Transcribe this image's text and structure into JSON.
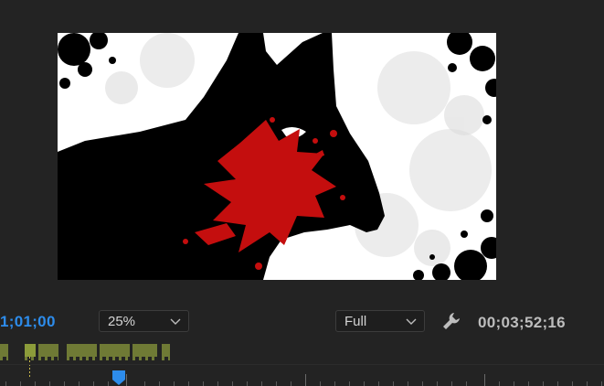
{
  "program_monitor": {
    "current_timecode": "1;01;00",
    "zoom_level": "25%",
    "playback_resolution": "Full",
    "duration_timecode": "00;03;52;16",
    "icons": {
      "settings": "wrench-icon",
      "dropdown": "chevron-down-icon",
      "playhead": "playhead-icon"
    }
  },
  "colors": {
    "timecode_blue": "#2d8ceb",
    "marker_green": "#6f7a35",
    "panel_bg": "#232323",
    "blood_red": "#c40e0e"
  }
}
